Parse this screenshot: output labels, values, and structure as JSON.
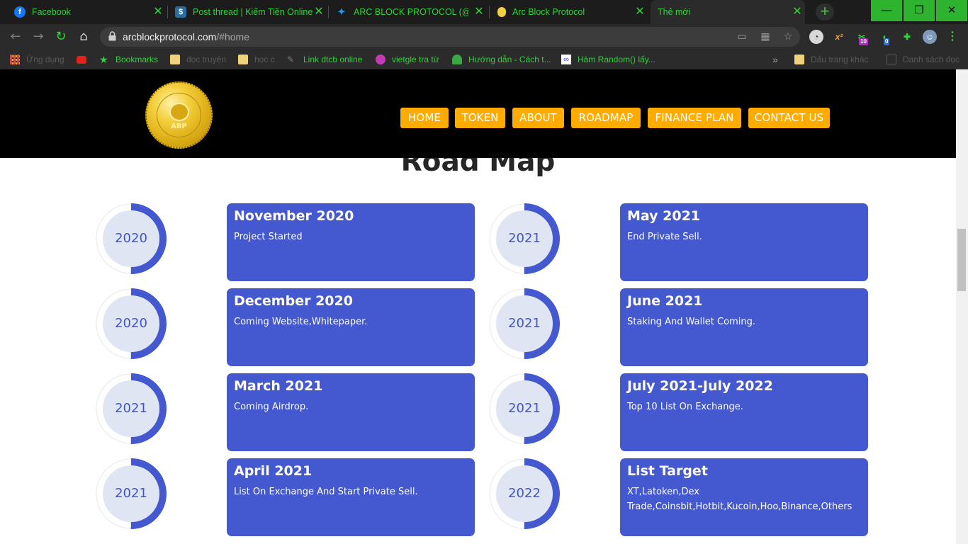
{
  "browser": {
    "tabs": [
      {
        "title": "Facebook",
        "icon": "facebook-icon",
        "color": "#1877f2"
      },
      {
        "title": "Post thread | Kiếm Tiền Online",
        "icon": "dollar-icon",
        "color": "#2b6ca3"
      },
      {
        "title": "ARC BLOCK PROTOCOL (@Prot",
        "icon": "twitter-icon",
        "color": "#1da1f2"
      },
      {
        "title": "Arc Block Protocol",
        "icon": "coin-icon",
        "color": "#f4cf3d"
      },
      {
        "title": "Thẻ mới",
        "icon": "none",
        "color": "#2b2b2b"
      }
    ],
    "new_tab": "+",
    "window_controls": {
      "minimize": "—",
      "restore": "❐",
      "close": "✕"
    },
    "url_host": "arcblockprotocol.com",
    "url_path": "/#home",
    "extension_badges": {
      "green": "10",
      "blue": "0"
    },
    "bookmarks": [
      {
        "label": "Ứng dụng",
        "icon": "apps-grid-icon",
        "dim": true
      },
      {
        "label": "",
        "icon": "youtube-icon",
        "dim": false
      },
      {
        "label": "Bookmarks",
        "icon": "star-icon",
        "dim": false
      },
      {
        "label": "đọc truyện",
        "icon": "folder-icon",
        "dim": true
      },
      {
        "label": "học c",
        "icon": "folder-icon",
        "dim": true
      },
      {
        "label": "Link dtcb online",
        "icon": "feather-icon",
        "dim": false
      },
      {
        "label": "vietgle tra từ",
        "icon": "vietgle-icon",
        "dim": false
      },
      {
        "label": "Hướng dẫn - Cách t...",
        "icon": "mushroom-icon",
        "dim": false
      },
      {
        "label": "Hàm Random() lấy...",
        "icon": "infinity-icon",
        "dim": false
      }
    ],
    "bookmarks_more": "»",
    "other_bookmarks": "Dấu trang khác",
    "reading_list": "Danh sách đọc"
  },
  "site": {
    "logo_text": "ABP",
    "nav": [
      "HOME",
      "TOKEN",
      "ABOUT",
      "ROADMAP",
      "FINANCE PLAN",
      "CONTACT US"
    ],
    "section_title": "Road Map"
  },
  "roadmap": [
    {
      "year": "2020",
      "title": "November 2020",
      "desc": "Project Started",
      "progress": 0.5
    },
    {
      "year": "2021",
      "title": "May 2021",
      "desc": "End Private Sell.",
      "progress": 0.5
    },
    {
      "year": "2020",
      "title": "December 2020",
      "desc": "Coming Website,Whitepaper.",
      "progress": 0.5
    },
    {
      "year": "2021",
      "title": "June 2021",
      "desc": "Staking And Wallet Coming.",
      "progress": 0.5
    },
    {
      "year": "2021",
      "title": "March 2021",
      "desc": "Coming Airdrop.",
      "progress": 0.5
    },
    {
      "year": "2021",
      "title": "July 2021-July 2022",
      "desc": "Top 10 List On Exchange.",
      "progress": 0.5
    },
    {
      "year": "2021",
      "title": "April 2021",
      "desc": "List On Exchange And Start Private Sell.",
      "progress": 0.5
    },
    {
      "year": "2022",
      "title": "List Target",
      "desc": "XT,Latoken,Dex Trade,Coinsbit,Hotbit,Kucoin,Hoo,Binance,Others",
      "progress": 0.5
    }
  ],
  "colors": {
    "accent": "#4458cf",
    "nav_button": "#ffab00",
    "ring_fill": "#dfe5f3",
    "browser_green": "#32d23c"
  }
}
